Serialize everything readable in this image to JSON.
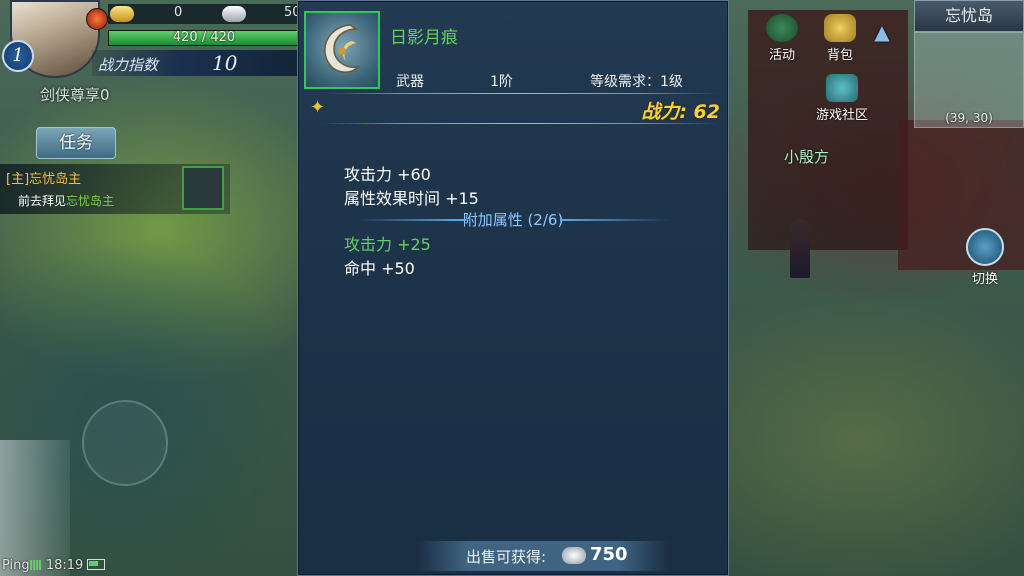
{
  "hud": {
    "level": "1",
    "gold": "0",
    "silver": "50",
    "hp_text": "420 / 420",
    "hp_fraction": 1.0,
    "power_label": "战力指数",
    "power_value": "10",
    "player_title": "剑侠尊享0",
    "task_button": "任务",
    "quest_title": "[主]忘忧岛主",
    "quest_desc_prefix": "前去拜见",
    "quest_desc_highlight": "忘忧岛主",
    "status": {
      "ping_label": "Ping",
      "time": "18:19"
    }
  },
  "right_hud": {
    "activity_label": "活动",
    "bag_label": "背包",
    "community_label": "游戏社区",
    "map_name": "忘忧岛",
    "coords": "(39, 30)",
    "npc_name": "小殷方",
    "switch_label": "切换"
  },
  "tooltip": {
    "item_name": "日影月痕",
    "type": "武器",
    "tier": "1阶",
    "level_req": "等级需求：1级",
    "power": "战力: 62",
    "base_stats": [
      {
        "text": "攻击力  +60"
      },
      {
        "text": "属性效果时间  +15"
      }
    ],
    "extra_header": "附加属性 (2/6)",
    "extra_stats": [
      {
        "text": "攻击力  +25"
      },
      {
        "text": "命中  +50"
      }
    ],
    "sell_label": "出售可获得:",
    "sell_value": "750"
  },
  "colors": {
    "item_name": "#5fd35f",
    "power": "#f4d23a",
    "extra_header": "#8ac8ff",
    "panel_bg": "#1c3248"
  }
}
